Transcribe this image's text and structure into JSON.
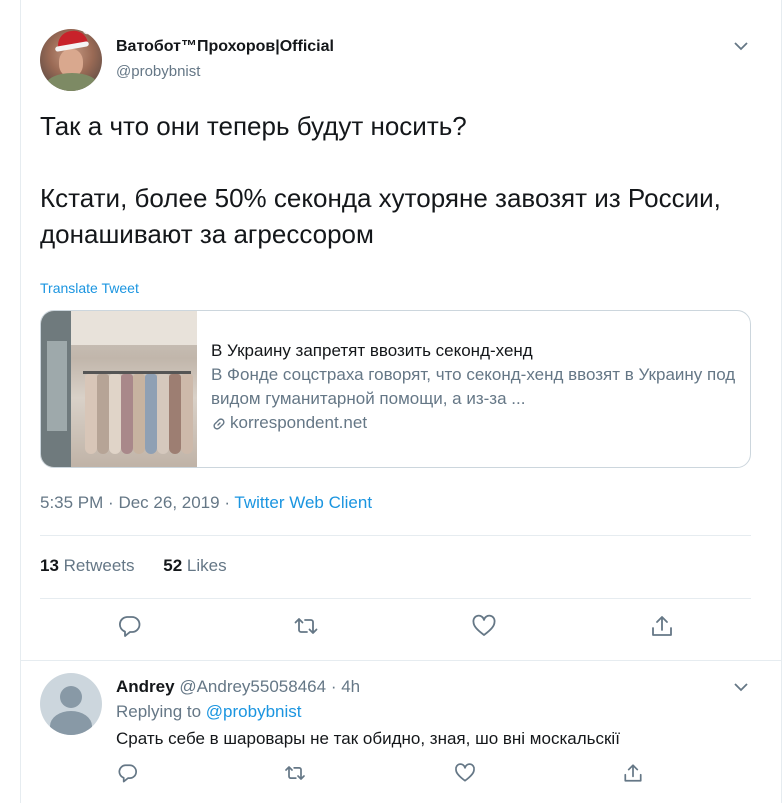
{
  "tweet": {
    "display_name": "Ватобот™Прохоров|Official",
    "handle": "@probybnist",
    "text": "Так а что они теперь будут носить?\n\nКстати, более 50% секонда хуторяне завозят из России, донашивают за агрессором",
    "translate_label": "Translate Tweet",
    "card": {
      "title": "В Украину запретят ввозить секонд-хенд",
      "description": "В Фонде соцстраха говорят, что секонд-хенд ввозят в Украину под видом гуманитарной помощи, а из-за ...",
      "domain": "korrespondent.net"
    },
    "time": "5:35 PM",
    "date": "Dec 26, 2019",
    "separator": "·",
    "client": "Twitter Web Client",
    "retweets_count": "13",
    "retweets_label": "Retweets",
    "likes_count": "52",
    "likes_label": "Likes",
    "icons": [
      "chevron-down-icon",
      "reply-icon",
      "retweet-icon",
      "like-icon",
      "share-icon",
      "link-icon"
    ]
  },
  "reply": {
    "display_name": "Andrey",
    "handle": "@Andrey55058464",
    "time": "4h",
    "separator": "·",
    "replying_prefix": "Replying to",
    "replying_to": "@probybnist",
    "text": "Срать себе в шаровары не так обидно, зная, шо вні москальскії"
  },
  "colors": {
    "accent": "#1b95e0",
    "text": "#14171a",
    "secondary": "#657786",
    "border": "#e6ecf0"
  }
}
